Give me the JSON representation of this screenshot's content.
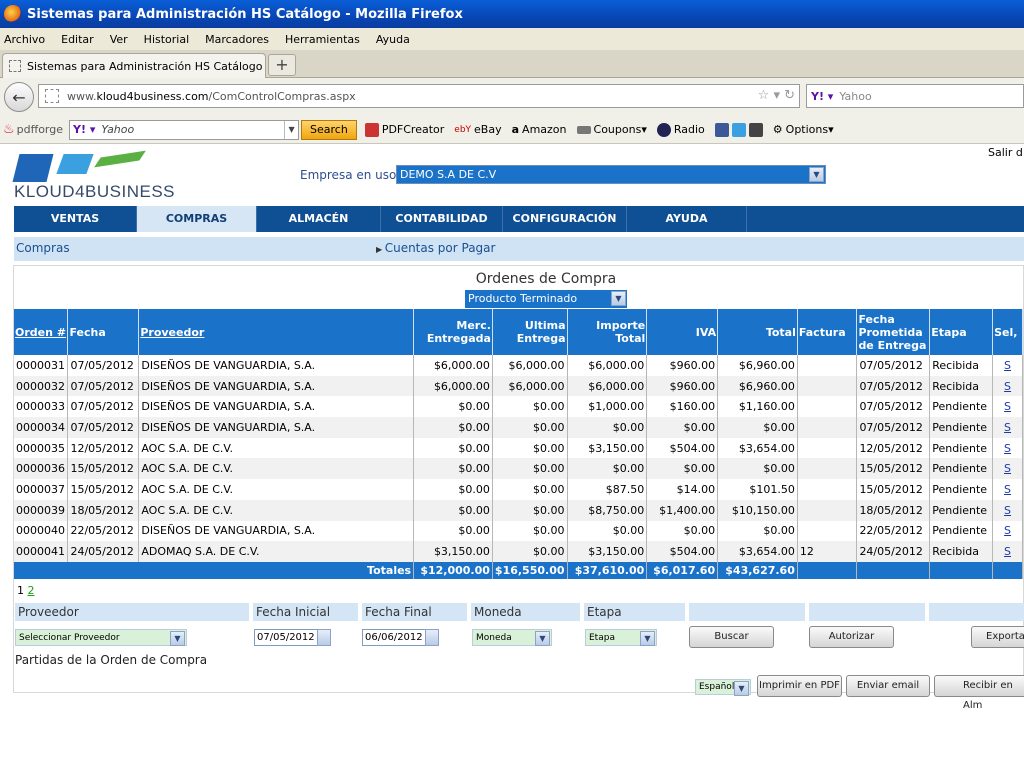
{
  "window": {
    "title": "Sistemas para Administración HS Catálogo - Mozilla Firefox"
  },
  "menu": [
    "Archivo",
    "Editar",
    "Ver",
    "Historial",
    "Marcadores",
    "Herramientas",
    "Ayuda"
  ],
  "browser_tab": {
    "title": "Sistemas para Administración HS Catálogo"
  },
  "address": {
    "prefix": "www.",
    "domain": "kloud4business.com",
    "path": "/ComControlCompras.aspx"
  },
  "search_engine": {
    "placeholder": "Yahoo"
  },
  "toolbar": {
    "pdfforge": "pdfforge",
    "yahoo_placeholder": "Yahoo",
    "search_button": "Search",
    "items": [
      "PDFCreator",
      "eBay",
      "Amazon",
      "Coupons",
      "Radio",
      "Options"
    ]
  },
  "app": {
    "logo_text": "KLOUD4BUSINESS",
    "salir": "Salir d",
    "empresa_label": "Empresa en uso:",
    "empresa_value": "DEMO S.A DE C.V",
    "nav": [
      "VENTAS",
      "COMPRAS",
      "ALMACÉN",
      "CONTABILIDAD",
      "CONFIGURACIÓN",
      "AYUDA"
    ],
    "breadcrumb": "Compras",
    "cuentas_link": "Cuentas por Pagar",
    "title": "Ordenes de Compra",
    "product_filter": "Producto Terminado"
  },
  "table": {
    "headers": {
      "orden": "Orden #",
      "fecha": "Fecha",
      "proveedor": "Proveedor",
      "merc": "Merc. Entregada",
      "ultima": "Ultima Entrega",
      "importe": "Importe Total",
      "iva": "IVA",
      "total": "Total",
      "factura": "Factura",
      "fecha_prom": "Fecha Prometida de Entrega",
      "etapa": "Etapa",
      "sel": "Sel,"
    },
    "rows": [
      [
        "0000031",
        "07/05/2012",
        "DISEÑOS DE VANGUARDIA, S.A.",
        "$6,000.00",
        "$6,000.00",
        "$6,000.00",
        "$960.00",
        "$6,960.00",
        "",
        "07/05/2012",
        "Recibida",
        "S"
      ],
      [
        "0000032",
        "07/05/2012",
        "DISEÑOS DE VANGUARDIA, S.A.",
        "$6,000.00",
        "$6,000.00",
        "$6,000.00",
        "$960.00",
        "$6,960.00",
        "",
        "07/05/2012",
        "Recibida",
        "S"
      ],
      [
        "0000033",
        "07/05/2012",
        "DISEÑOS DE VANGUARDIA, S.A.",
        "$0.00",
        "$0.00",
        "$1,000.00",
        "$160.00",
        "$1,160.00",
        "",
        "07/05/2012",
        "Pendiente",
        "S"
      ],
      [
        "0000034",
        "07/05/2012",
        "DISEÑOS DE VANGUARDIA, S.A.",
        "$0.00",
        "$0.00",
        "$0.00",
        "$0.00",
        "$0.00",
        "",
        "07/05/2012",
        "Pendiente",
        "S"
      ],
      [
        "0000035",
        "12/05/2012",
        "AOC S.A. DE C.V.",
        "$0.00",
        "$0.00",
        "$3,150.00",
        "$504.00",
        "$3,654.00",
        "",
        "12/05/2012",
        "Pendiente",
        "S"
      ],
      [
        "0000036",
        "15/05/2012",
        "AOC S.A. DE C.V.",
        "$0.00",
        "$0.00",
        "$0.00",
        "$0.00",
        "$0.00",
        "",
        "15/05/2012",
        "Pendiente",
        "S"
      ],
      [
        "0000037",
        "15/05/2012",
        "AOC S.A. DE C.V.",
        "$0.00",
        "$0.00",
        "$87.50",
        "$14.00",
        "$101.50",
        "",
        "15/05/2012",
        "Pendiente",
        "S"
      ],
      [
        "0000039",
        "18/05/2012",
        "AOC S.A. DE C.V.",
        "$0.00",
        "$0.00",
        "$8,750.00",
        "$1,400.00",
        "$10,150.00",
        "",
        "18/05/2012",
        "Pendiente",
        "S"
      ],
      [
        "0000040",
        "22/05/2012",
        "DISEÑOS DE VANGUARDIA, S.A.",
        "$0.00",
        "$0.00",
        "$0.00",
        "$0.00",
        "$0.00",
        "",
        "22/05/2012",
        "Pendiente",
        "S"
      ],
      [
        "0000041",
        "24/05/2012",
        "ADOMAQ S.A. DE C.V.",
        "$3,150.00",
        "$0.00",
        "$3,150.00",
        "$504.00",
        "$3,654.00",
        "12",
        "24/05/2012",
        "Recibida",
        "S"
      ]
    ],
    "totals": {
      "label": "Totales",
      "merc": "$12,000.00",
      "ultima": "$16,550.00",
      "importe": "$37,610.00",
      "iva": "$6,017.60",
      "total": "$43,627.60"
    }
  },
  "pager": {
    "current": "1",
    "next": "2"
  },
  "filters": {
    "proveedor_label": "Proveedor",
    "proveedor_value": "Seleccionar Proveedor",
    "fecha_ini_label": "Fecha Inicial",
    "fecha_ini_value": "07/05/2012",
    "fecha_fin_label": "Fecha Final",
    "fecha_fin_value": "06/06/2012",
    "moneda_label": "Moneda",
    "moneda_value": "Moneda",
    "etapa_label": "Etapa",
    "etapa_value": "Etapa",
    "buscar": "Buscar",
    "autorizar": "Autorizar",
    "exportar": "Exportar"
  },
  "partidas": {
    "label": "Partidas de la Orden de Compra",
    "language": "Español",
    "imprimir": "Imprimir en PDF",
    "enviar": "Enviar email",
    "recibir": "Recibir en Alm"
  },
  "colors": {
    "header_blue": "#1a73c9",
    "nav_blue": "#0f4f93",
    "subnav": "#cfe3f4"
  }
}
